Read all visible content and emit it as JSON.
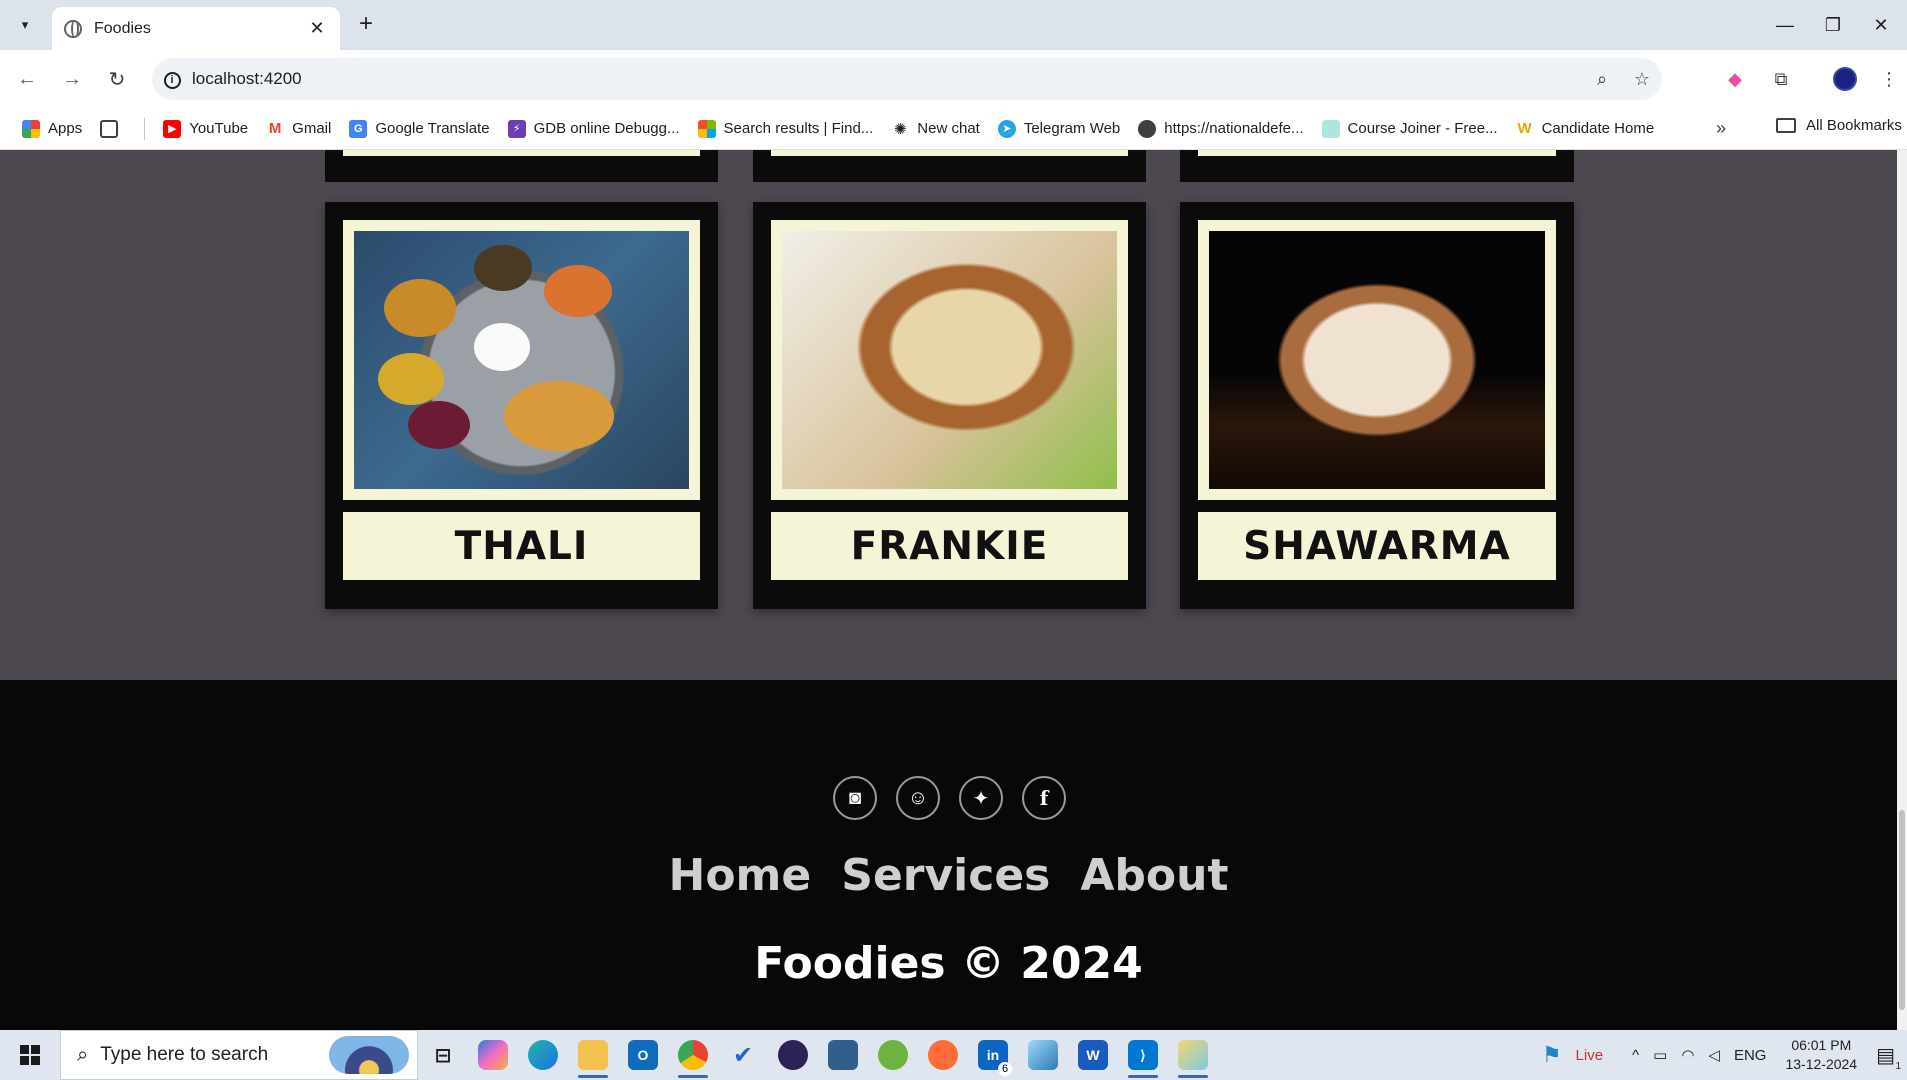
{
  "browser": {
    "tab_title": "Foodies",
    "url": "localhost:4200",
    "bookmarks": [
      {
        "label": "Apps",
        "icon": "apps-grid-icon",
        "color": "#ea4335"
      },
      {
        "label": "",
        "icon": "tab-groups-icon",
        "color": "#3c4043"
      },
      {
        "label": "YouTube",
        "icon": "youtube-icon",
        "color": "#ff0000"
      },
      {
        "label": "Gmail",
        "icon": "gmail-icon",
        "color": "#ea4335"
      },
      {
        "label": "Google Translate",
        "icon": "google-translate-icon",
        "color": "#4285f4"
      },
      {
        "label": "GDB online Debugg...",
        "icon": "gdb-icon",
        "color": "#6a3fb5"
      },
      {
        "label": "Search results | Find...",
        "icon": "microsoft-icon",
        "color": "#f25022"
      },
      {
        "label": "New chat",
        "icon": "openai-icon",
        "color": "#1f1f1f"
      },
      {
        "label": "Telegram Web",
        "icon": "telegram-icon",
        "color": "#2aa3df"
      },
      {
        "label": "https://nationaldefe...",
        "icon": "globe-icon",
        "color": "#3c4043"
      },
      {
        "label": "Course Joiner - Free...",
        "icon": "course-joiner-icon",
        "color": "#78d1c8"
      },
      {
        "label": "Candidate Home",
        "icon": "candidate-home-icon",
        "color": "#e6a700"
      }
    ],
    "all_bookmarks": "All Bookmarks"
  },
  "page": {
    "cards": [
      {
        "name": "THALI",
        "image": "thali-photo"
      },
      {
        "name": "FRANKIE",
        "image": "frankie-photo"
      },
      {
        "name": "SHAWARMA",
        "image": "shawarma-photo"
      }
    ],
    "footer": {
      "social": [
        "instagram-icon",
        "snapchat-icon",
        "twitter-icon",
        "facebook-icon"
      ],
      "links": [
        "Home",
        "Services",
        "About"
      ],
      "copyright": "Foodies © 2024"
    }
  },
  "taskbar": {
    "search_placeholder": "Type here to search",
    "linkedin_badge": "6",
    "weather_label": "Live",
    "language": "ENG",
    "time": "06:01 PM",
    "date": "13-12-2024",
    "notification_count": "1"
  },
  "colors": {
    "page_bg": "#4d4750",
    "card_bg": "#0b0b0b",
    "card_cream": "#f6f4d7",
    "footer_bg": "#080808"
  }
}
